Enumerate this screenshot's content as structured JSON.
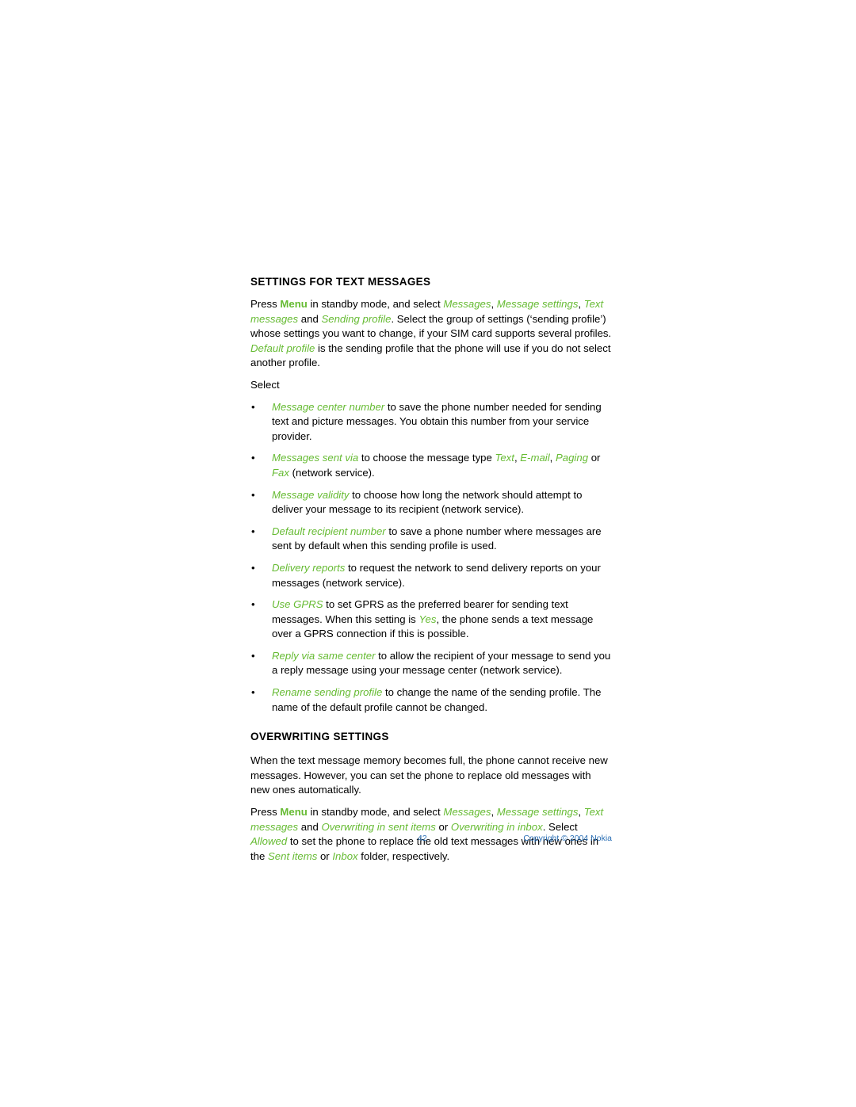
{
  "document": {
    "page_number": "42",
    "copyright": "Copyright © 2004 Nokia",
    "accent_color": "#66bb33",
    "footer_color": "#2a6fb5"
  },
  "sections": [
    {
      "heading": "SETTINGS FOR TEXT MESSAGES",
      "intro": {
        "t1": "Press ",
        "menu": "Menu",
        "t2": " in standby mode, and select ",
        "m1": "Messages",
        "t3": ", ",
        "m2": "Message settings",
        "t4": ", ",
        "m3": "Text messages",
        "t5": " and ",
        "m4": "Sending profile",
        "t6": ". Select the group of settings (‘sending profile’) whose settings you want to change, if your SIM card supports several profiles. ",
        "m5": "Default profile",
        "t7": " is the sending profile that the phone will use if you do not select another profile."
      },
      "select_line": "Select",
      "bullets": [
        {
          "term": "Message center number",
          "rest": " to save the phone number needed for sending text and picture messages. You obtain this number from your service provider."
        },
        {
          "term": "Messages sent via",
          "mid": " to choose the message type ",
          "opt1": "Text",
          "sep1": ", ",
          "opt2": "E-mail",
          "sep2": ", ",
          "opt3": "Paging",
          "sep3": " or ",
          "opt4": "Fax",
          "rest": " (network service)."
        },
        {
          "term": "Message validity",
          "rest": " to choose how long the network should attempt to deliver your message to its recipient (network service)."
        },
        {
          "term": "Default recipient number",
          "rest": " to save a phone number where messages are sent by default when this sending profile is used."
        },
        {
          "term": "Delivery reports",
          "rest": " to request the network to send delivery reports on your messages (network service)."
        },
        {
          "term": "Use GPRS",
          "mid": " to set GPRS as the preferred bearer for sending text messages. When this setting is ",
          "opt1": "Yes",
          "rest": ", the phone sends a text message over a GPRS connection if this is possible."
        },
        {
          "term": "Reply via same center",
          "rest": " to allow the recipient of your message to send you a reply message using your message center (network service)."
        },
        {
          "term": "Rename sending profile",
          "rest": " to change the name of the sending profile. The name of the default profile cannot be changed."
        }
      ]
    },
    {
      "heading": "OVERWRITING SETTINGS",
      "para1": "When the text message memory becomes full, the phone cannot receive new messages. However, you can set the phone to replace old messages with new ones automatically.",
      "para2": {
        "t1": "Press ",
        "menu": "Menu",
        "t2": " in standby mode, and select ",
        "m1": "Messages",
        "t3": ", ",
        "m2": "Message settings",
        "t4": ", ",
        "m3": "Text messages",
        "t5": " and ",
        "m4": "Overwriting in sent items",
        "t6": " or ",
        "m5": "Overwriting in inbox",
        "t7": ". Select ",
        "m6": "Allowed",
        "t8": " to set the phone to replace the old text messages with new ones in the ",
        "m7": "Sent items",
        "t9": " or ",
        "m8": "Inbox",
        "t10": " folder, respectively."
      }
    }
  ]
}
